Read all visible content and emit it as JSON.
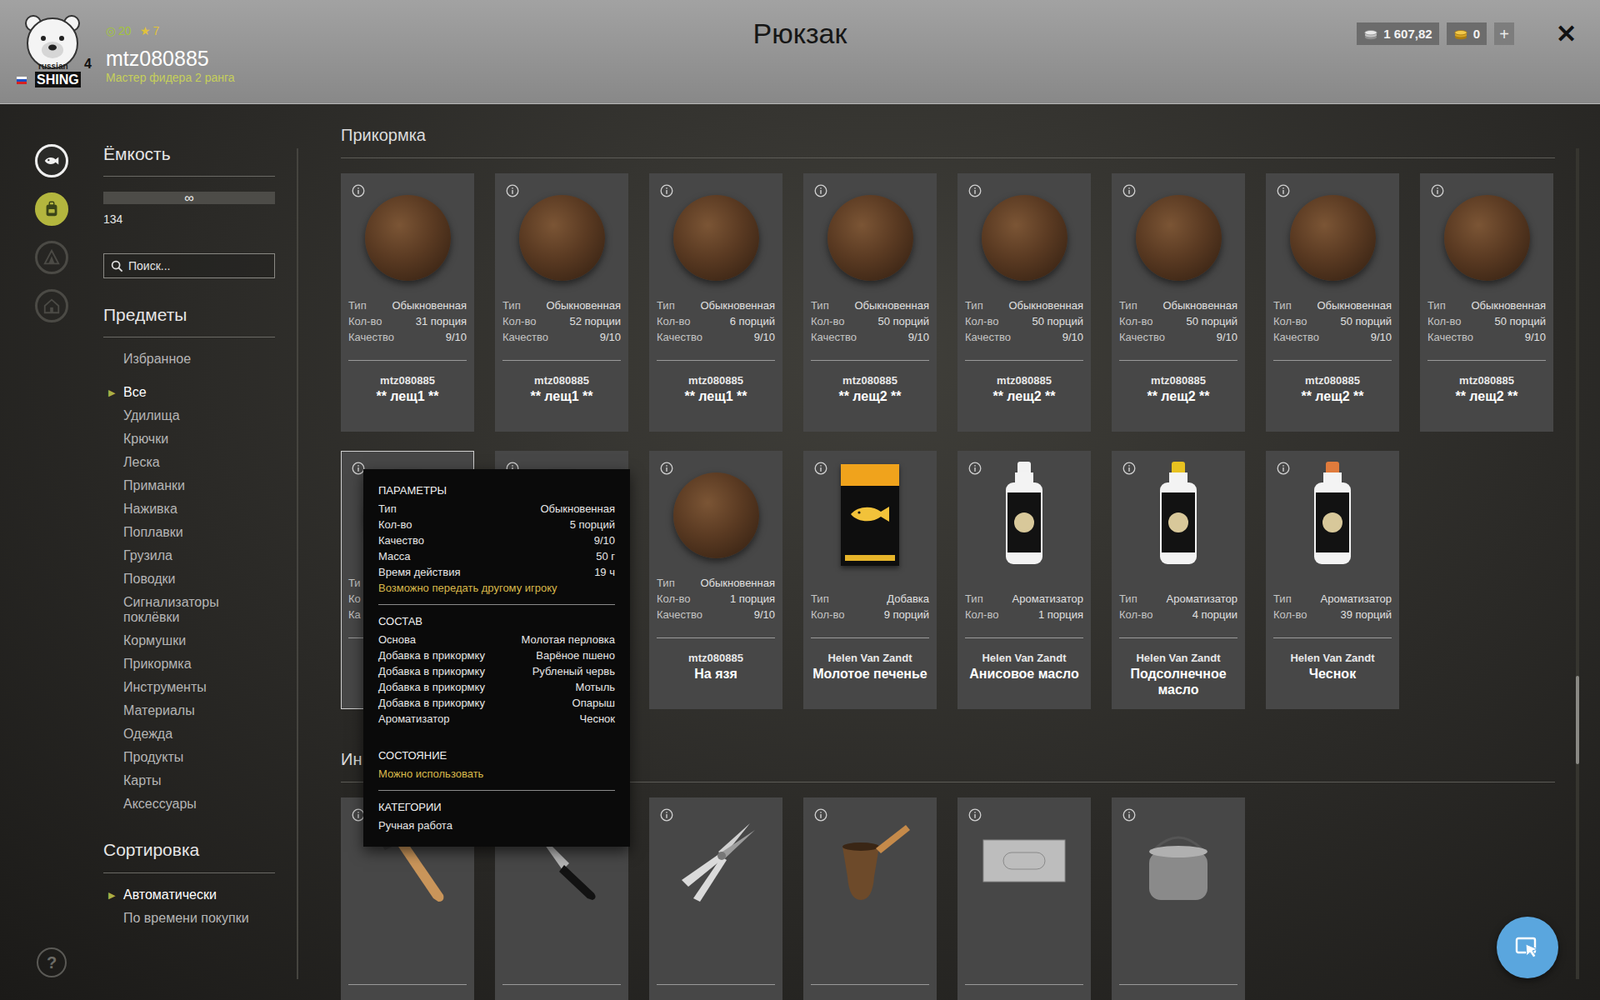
{
  "header": {
    "logo": {
      "top": "russian",
      "bottom": "SHING",
      "number": "4"
    },
    "stats": [
      {
        "symbol": "◎",
        "value": "20",
        "color": "#a3c43c"
      },
      {
        "symbol": "★",
        "value": "7",
        "color": "#e0c23c"
      }
    ],
    "player": "mtz080885",
    "rank": "Мастер фидера 2 ранга",
    "title": "Рюкзак",
    "currencies": [
      {
        "kind": "silver",
        "amount": "1 607,82"
      },
      {
        "kind": "gold",
        "amount": "0"
      }
    ],
    "add_button": "+",
    "close_button": "✕"
  },
  "nav": [
    {
      "kind": "fish",
      "selected": false,
      "disabled": false
    },
    {
      "kind": "backpack",
      "selected": true,
      "disabled": false
    },
    {
      "kind": "tent",
      "selected": false,
      "disabled": true
    },
    {
      "kind": "home",
      "selected": false,
      "disabled": true
    }
  ],
  "sidebar": {
    "capacity": {
      "title": "Ёмкость",
      "bar": "∞",
      "count": "134"
    },
    "search": {
      "placeholder": "Поиск..."
    },
    "items_title": "Предметы",
    "marker": "▶",
    "categories": [
      {
        "label": "Избранное",
        "selected": false
      },
      {
        "label": "Все",
        "selected": true
      },
      {
        "label": "Удилища",
        "selected": false
      },
      {
        "label": "Крючки",
        "selected": false
      },
      {
        "label": "Леска",
        "selected": false
      },
      {
        "label": "Приманки",
        "selected": false
      },
      {
        "label": "Наживка",
        "selected": false
      },
      {
        "label": "Поплавки",
        "selected": false
      },
      {
        "label": "Грузила",
        "selected": false
      },
      {
        "label": "Поводки",
        "selected": false
      },
      {
        "label": "Сигнализаторы поклёвки",
        "selected": false
      },
      {
        "label": "Кормушки",
        "selected": false
      },
      {
        "label": "Прикормка",
        "selected": false
      },
      {
        "label": "Инструменты",
        "selected": false
      },
      {
        "label": "Материалы",
        "selected": false
      },
      {
        "label": "Одежда",
        "selected": false
      },
      {
        "label": "Продукты",
        "selected": false
      },
      {
        "label": "Карты",
        "selected": false
      },
      {
        "label": "Аксессуары",
        "selected": false
      }
    ],
    "sort_title": "Сортировка",
    "sort_options": [
      {
        "label": "Автоматически",
        "selected": true
      },
      {
        "label": "По времени покупки",
        "selected": false
      }
    ]
  },
  "help": "?",
  "sections": [
    {
      "title": "Прикормка",
      "cards": [
        {
          "kind": "groundbait",
          "selected": false,
          "rows": [
            {
              "label": "Тип",
              "value": "Обыкновенная"
            },
            {
              "label": "Кол-во",
              "value": "31 порция"
            },
            {
              "label": "Качество",
              "value": "9/10"
            }
          ],
          "owner": "mtz080885",
          "name": "** лещ1 **"
        },
        {
          "kind": "groundbait",
          "selected": false,
          "rows": [
            {
              "label": "Тип",
              "value": "Обыкновенная"
            },
            {
              "label": "Кол-во",
              "value": "52 порции"
            },
            {
              "label": "Качество",
              "value": "9/10"
            }
          ],
          "owner": "mtz080885",
          "name": "** лещ1 **"
        },
        {
          "kind": "groundbait",
          "selected": false,
          "rows": [
            {
              "label": "Тип",
              "value": "Обыкновенная"
            },
            {
              "label": "Кол-во",
              "value": "6 порций"
            },
            {
              "label": "Качество",
              "value": "9/10"
            }
          ],
          "owner": "mtz080885",
          "name": "** лещ1 **"
        },
        {
          "kind": "groundbait",
          "selected": false,
          "rows": [
            {
              "label": "Тип",
              "value": "Обыкновенная"
            },
            {
              "label": "Кол-во",
              "value": "50 порций"
            },
            {
              "label": "Качество",
              "value": "9/10"
            }
          ],
          "owner": "mtz080885",
          "name": "** лещ2 **"
        },
        {
          "kind": "groundbait",
          "selected": false,
          "rows": [
            {
              "label": "Тип",
              "value": "Обыкновенная"
            },
            {
              "label": "Кол-во",
              "value": "50 порций"
            },
            {
              "label": "Качество",
              "value": "9/10"
            }
          ],
          "owner": "mtz080885",
          "name": "** лещ2 **"
        },
        {
          "kind": "groundbait",
          "selected": false,
          "rows": [
            {
              "label": "Тип",
              "value": "Обыкновенная"
            },
            {
              "label": "Кол-во",
              "value": "50 порций"
            },
            {
              "label": "Качество",
              "value": "9/10"
            }
          ],
          "owner": "mtz080885",
          "name": "** лещ2 **"
        },
        {
          "kind": "groundbait",
          "selected": false,
          "rows": [
            {
              "label": "Тип",
              "value": "Обыкновенная"
            },
            {
              "label": "Кол-во",
              "value": "50 порций"
            },
            {
              "label": "Качество",
              "value": "9/10"
            }
          ],
          "owner": "mtz080885",
          "name": "** лещ2 **"
        },
        {
          "kind": "groundbait",
          "selected": false,
          "rows": [
            {
              "label": "Тип",
              "value": "Обыкновенная"
            },
            {
              "label": "Кол-во",
              "value": "50 порций"
            },
            {
              "label": "Качество",
              "value": "9/10"
            }
          ],
          "owner": "mtz080885",
          "name": "** лещ2 **"
        },
        {
          "kind": "groundbait",
          "selected": true,
          "rows": [
            {
              "label": "Ти"
            },
            {
              "label": "Ко"
            },
            {
              "label": "Ка"
            }
          ]
        },
        {
          "kind": "groundbait",
          "selected": false,
          "rows": []
        },
        {
          "kind": "groundbait",
          "selected": false,
          "rows": [
            {
              "label": "Тип",
              "value": "Обыкновенная"
            },
            {
              "label": "Кол-во",
              "value": "1 порция"
            },
            {
              "label": "Качество",
              "value": "9/10"
            }
          ],
          "owner": "mtz080885",
          "name": "На язя"
        },
        {
          "kind": "package",
          "selected": false,
          "rows": [
            {
              "label": "Тип",
              "value": "Добавка"
            },
            {
              "label": "Кол-во",
              "value": "9 порций"
            }
          ],
          "owner": "Helen Van Zandt",
          "name": "Молотое печенье"
        },
        {
          "kind": "bottle",
          "color": "#f2f2f2",
          "selected": false,
          "rows": [
            {
              "label": "Тип",
              "value": "Ароматизатор"
            },
            {
              "label": "Кол-во",
              "value": "1 порция"
            }
          ],
          "owner": "Helen Van Zandt",
          "name": "Анисовое масло"
        },
        {
          "kind": "bottle",
          "color": "#e8c220",
          "selected": false,
          "rows": [
            {
              "label": "Тип",
              "value": "Ароматизатор"
            },
            {
              "label": "Кол-во",
              "value": "4 порции"
            }
          ],
          "owner": "Helen Van Zandt",
          "name": "Подсолнечное масло"
        },
        {
          "kind": "bottle",
          "color": "#e07b3c",
          "selected": false,
          "rows": [
            {
              "label": "Тип",
              "value": "Ароматизатор"
            },
            {
              "label": "Кол-во",
              "value": "39 порций"
            }
          ],
          "owner": "Helen Van Zandt",
          "name": "Чеснок"
        }
      ]
    },
    {
      "title": "Ин",
      "cards": [
        {
          "kind": "mallet",
          "selected": false,
          "rows": []
        },
        {
          "kind": "knife",
          "selected": false,
          "rows": []
        },
        {
          "kind": "pliers",
          "selected": false,
          "rows": []
        },
        {
          "kind": "cezve",
          "selected": false,
          "rows": []
        },
        {
          "kind": "plate",
          "selected": false,
          "rows": []
        },
        {
          "kind": "kettle",
          "selected": false,
          "rows": []
        }
      ]
    }
  ],
  "tooltip": {
    "sections": [
      {
        "title": "ПАРАМЕТРЫ",
        "rows": [
          {
            "label": "Тип",
            "value": "Обыкновенная"
          },
          {
            "label": "Кол-во",
            "value": "5 порций"
          },
          {
            "label": "Качество",
            "value": "9/10"
          },
          {
            "label": "Масса",
            "value": "50 г"
          },
          {
            "label": "Время действия",
            "value": "19 ч"
          }
        ],
        "notes": [
          {
            "text": "Возможно передать другому игроку",
            "highlight": true
          }
        ]
      },
      {
        "title": "СОСТАВ",
        "rows": [
          {
            "label": "Основа",
            "value": "Молотая перловка"
          },
          {
            "label": "Добавка в прикормку",
            "value": "Варёное пшено"
          },
          {
            "label": "Добавка в прикормку",
            "value": "Рубленый червь"
          },
          {
            "label": "Добавка в прикормку",
            "value": "Мотыль"
          },
          {
            "label": "Добавка в прикормку",
            "value": "Опарыш"
          },
          {
            "label": "Ароматизатор",
            "value": "Чеснок"
          }
        ]
      },
      {
        "title": "СОСТОЯНИЕ",
        "notes": [
          {
            "text": "Можно использовать",
            "highlight": true
          }
        ]
      },
      {
        "title": "КАТЕГОРИИ",
        "notes": [
          {
            "text": "Ручная работа",
            "highlight": false
          }
        ]
      }
    ]
  },
  "scrollbar": {
    "level": 0.71
  }
}
